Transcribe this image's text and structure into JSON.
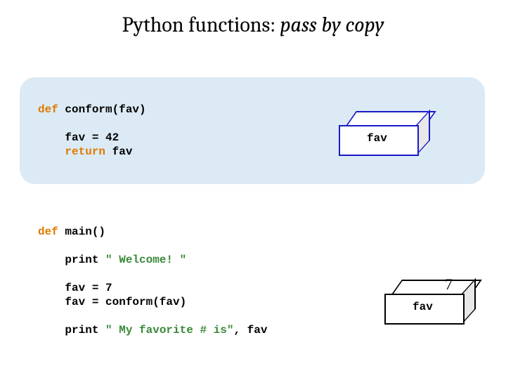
{
  "title": {
    "prefix": "Python functions: ",
    "suffix": "pass by copy"
  },
  "code": {
    "conform": {
      "l1a": "def",
      "l1b": " conform(fav)",
      "l2": "    fav = 42",
      "l3a": "    ",
      "l3b": "return",
      "l3c": " fav"
    },
    "main": {
      "l1a": "def",
      "l1b": " main()",
      "l2a": "    print ",
      "l2b": "\" Welcome! \"",
      "l3": "    fav = 7",
      "l4": "    fav = conform(fav)",
      "l5a": "    print ",
      "l5b": "\" My favorite # is\"",
      "l5c": ", fav"
    }
  },
  "boxes": {
    "conform_var": "fav",
    "main_var": "fav",
    "main_val": "7"
  }
}
